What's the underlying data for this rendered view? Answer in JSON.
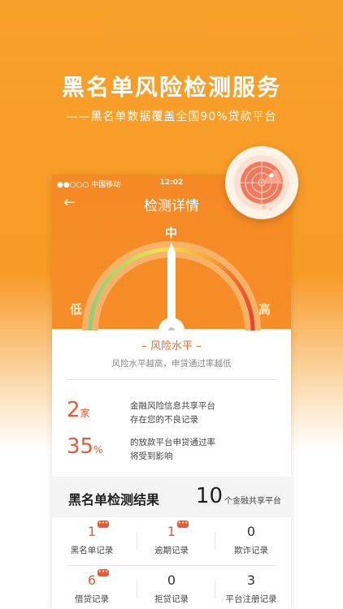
{
  "hero": {
    "title": "黑名单风险检测服务",
    "subtitle": "——黑名单数据覆盖全国90%贷款平台"
  },
  "status_bar": {
    "carrier": "●●○○○ 中国移动",
    "time": "12:02"
  },
  "nav": {
    "title": "检测详情"
  },
  "gauge": {
    "label_mid": "中",
    "label_low": "低",
    "label_high": "高",
    "level_fraction": 0.5
  },
  "risk": {
    "title": "– 风险水平 –",
    "subtitle": "风险水平越高，申贷通过率越低"
  },
  "stats": [
    {
      "value": "2",
      "unit": "家",
      "line1": "金融风险信息共享平台",
      "line2": "存在您的不良记录"
    },
    {
      "value": "35",
      "unit": "%",
      "line1": "的放款平台申贷通过率",
      "line2": "将受到影响"
    }
  ],
  "result": {
    "title": "黑名单检测结果",
    "count": "10",
    "count_label": "个金融共享平台"
  },
  "records": [
    {
      "value": "1",
      "label": "黑名单记录",
      "badge": "•••"
    },
    {
      "value": "1",
      "label": "逾期记录",
      "badge": "•••"
    },
    {
      "value": "0",
      "label": "欺诈记录"
    },
    {
      "value": "6",
      "label": "借贷记录",
      "badge": "•••"
    },
    {
      "value": "0",
      "label": "拒贷记录"
    },
    {
      "value": "3",
      "label": "平台注册记录"
    }
  ],
  "colors": {
    "brand_orange": "#f58a24",
    "accent_red": "#e85a35"
  }
}
